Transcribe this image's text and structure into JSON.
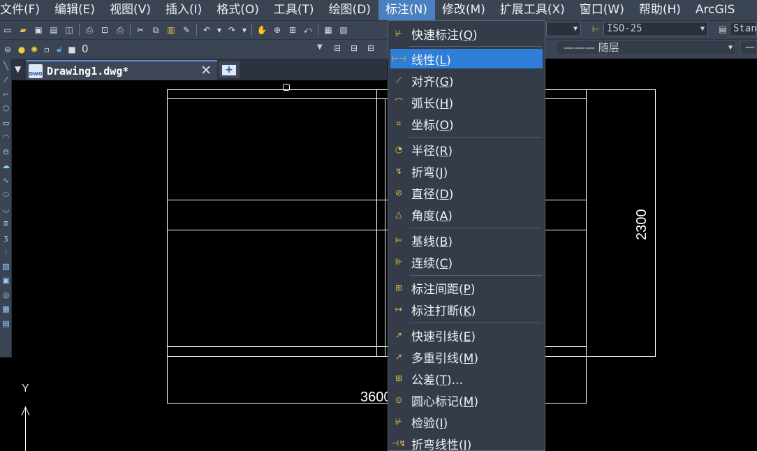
{
  "menubar": {
    "items": [
      {
        "label": "文件(F)"
      },
      {
        "label": "编辑(E)"
      },
      {
        "label": "视图(V)"
      },
      {
        "label": "插入(I)"
      },
      {
        "label": "格式(O)"
      },
      {
        "label": "工具(T)"
      },
      {
        "label": "绘图(D)"
      },
      {
        "label": "标注(N)",
        "active": true
      },
      {
        "label": "修改(M)"
      },
      {
        "label": "扩展工具(X)"
      },
      {
        "label": "窗口(W)"
      },
      {
        "label": "帮助(H)"
      },
      {
        "label": "ArcGIS"
      }
    ]
  },
  "toolbar": {
    "dim_style_value": "ISO-25",
    "text_style_value": "Stan",
    "layer_value": "0",
    "linetype_value": "——— 随层"
  },
  "tabs": {
    "doc_icon_text": "DWG",
    "doc_label": "Drawing1.dwg*",
    "close_glyph": "✕",
    "new_glyph": "+"
  },
  "canvas": {
    "dim_vertical": "2300",
    "dim_horizontal": "3600",
    "ucs_y": "Y"
  },
  "dropdown": {
    "items": [
      {
        "label": "快速标注",
        "key": "Q",
        "icon": "quick-dimension-icon"
      },
      {
        "label": "线性",
        "key": "L",
        "icon": "linear-dimension-icon",
        "highlighted": true
      },
      {
        "label": "对齐",
        "key": "G",
        "icon": "aligned-dimension-icon"
      },
      {
        "label": "弧长",
        "key": "H",
        "icon": "arc-length-icon"
      },
      {
        "label": "坐标",
        "key": "O",
        "icon": "ordinate-icon"
      },
      {
        "label": "半径",
        "key": "R",
        "icon": "radius-icon"
      },
      {
        "label": "折弯",
        "key": "J",
        "icon": "jogged-icon"
      },
      {
        "label": "直径",
        "key": "D",
        "icon": "diameter-icon"
      },
      {
        "label": "角度",
        "key": "A",
        "icon": "angular-icon"
      },
      {
        "label": "基线",
        "key": "B",
        "icon": "baseline-icon"
      },
      {
        "label": "连续",
        "key": "C",
        "icon": "continue-icon"
      },
      {
        "label": "标注间距",
        "key": "P",
        "icon": "dim-space-icon"
      },
      {
        "label": "标注打断",
        "key": "K",
        "icon": "dim-break-icon"
      },
      {
        "label": "快速引线",
        "key": "E",
        "icon": "quick-leader-icon"
      },
      {
        "label": "多重引线",
        "key": "M",
        "icon": "multileader-icon"
      },
      {
        "label": "公差",
        "key": "T",
        "suffix": "...",
        "icon": "tolerance-icon"
      },
      {
        "label": "圆心标记",
        "key": "M",
        "icon": "center-mark-icon"
      },
      {
        "label": "检验",
        "key": "I",
        "icon": "inspection-icon"
      },
      {
        "label": "折弯线性",
        "key": "J",
        "icon": "jogged-linear-icon"
      }
    ]
  }
}
